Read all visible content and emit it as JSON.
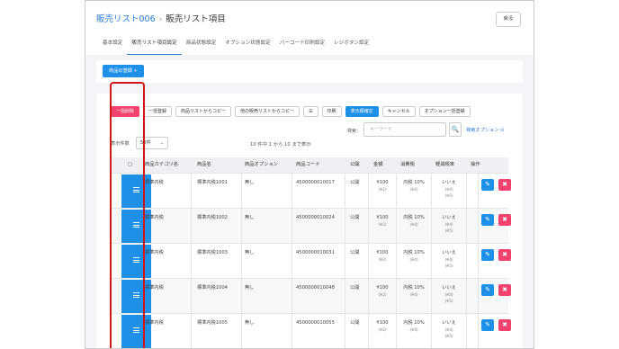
{
  "breadcrumb": {
    "parent": "販売リスト006",
    "separator": "›",
    "current": "販売リスト項目"
  },
  "back_label": "戻る",
  "tabs": [
    "基本設定",
    "販売リスト項目設定",
    "商品状態設定",
    "オプション状態設定",
    "バーコード印刷設定",
    "レジボタン設定"
  ],
  "register_button": "商品の登録 +",
  "toolbar": [
    "一括削除",
    "一括登録",
    "商品リストからコピー",
    "他の販売リストからコピー",
    "☰",
    "印刷",
    "表示順確定",
    "キャンセル",
    "オプション一括登録"
  ],
  "search": {
    "label": "検索：",
    "placeholder": "キーワード",
    "icon": "🔍",
    "advanced": "検索オプション ⊙"
  },
  "per_page": {
    "label": "表示件数",
    "value": "50件",
    "chevron": "⌄"
  },
  "pagination_info": "10 件中 1 から 10 まで表示",
  "columns": [
    "□",
    "商品カテゴリ名",
    "商品名",
    "商品オプション",
    "商品コード",
    "公開",
    "金額",
    "消費税",
    "軽減税率",
    "操作"
  ],
  "rows": [
    {
      "category": "標準内税",
      "name": "標準内税1001",
      "option": "無し",
      "code": "4500000010017",
      "public": "公開",
      "price": "¥100",
      "price_sub": "(※2)",
      "tax": "内税 10%",
      "tax_sub": "(※4)",
      "reduced": "いいえ",
      "reduced_sub1": "(※4)",
      "reduced_sub2": "(※5)"
    },
    {
      "category": "標準内税",
      "name": "標準内税1002",
      "option": "無し",
      "code": "4500000010024",
      "public": "公開",
      "price": "¥100",
      "price_sub": "(※2)",
      "tax": "内税 10%",
      "tax_sub": "(※4)",
      "reduced": "いいえ",
      "reduced_sub1": "(※4)",
      "reduced_sub2": "(※5)"
    },
    {
      "category": "標準内税",
      "name": "標準内税1003",
      "option": "無し",
      "code": "4500000010031",
      "public": "公開",
      "price": "¥100",
      "price_sub": "(※2)",
      "tax": "内税 10%",
      "tax_sub": "(※4)",
      "reduced": "いいえ",
      "reduced_sub1": "(※4)",
      "reduced_sub2": "(※5)"
    },
    {
      "category": "標準内税",
      "name": "標準内税1004",
      "option": "無し",
      "code": "4500000010048",
      "public": "公開",
      "price": "¥100",
      "price_sub": "(※2)",
      "tax": "内税 10%",
      "tax_sub": "(※4)",
      "reduced": "いいえ",
      "reduced_sub1": "(※4)",
      "reduced_sub2": "(※5)"
    },
    {
      "category": "標準内税",
      "name": "標準内税1005",
      "option": "無し",
      "code": "4500000010055",
      "public": "公開",
      "price": "¥100",
      "price_sub": "(※2)",
      "tax": "内税 10%",
      "tax_sub": "(※4)",
      "reduced": "いいえ",
      "reduced_sub1": "(※4)",
      "reduced_sub2": "(※5)"
    }
  ],
  "icons": {
    "drag": "drag-handle-icon",
    "edit": "edit-icon",
    "delete": "delete-icon"
  },
  "actions": {
    "edit_glyph": "✎",
    "delete_glyph": "✖"
  },
  "colors": {
    "primary": "#1e90e8",
    "danger": "#f0426c",
    "highlight": "#d01818"
  }
}
